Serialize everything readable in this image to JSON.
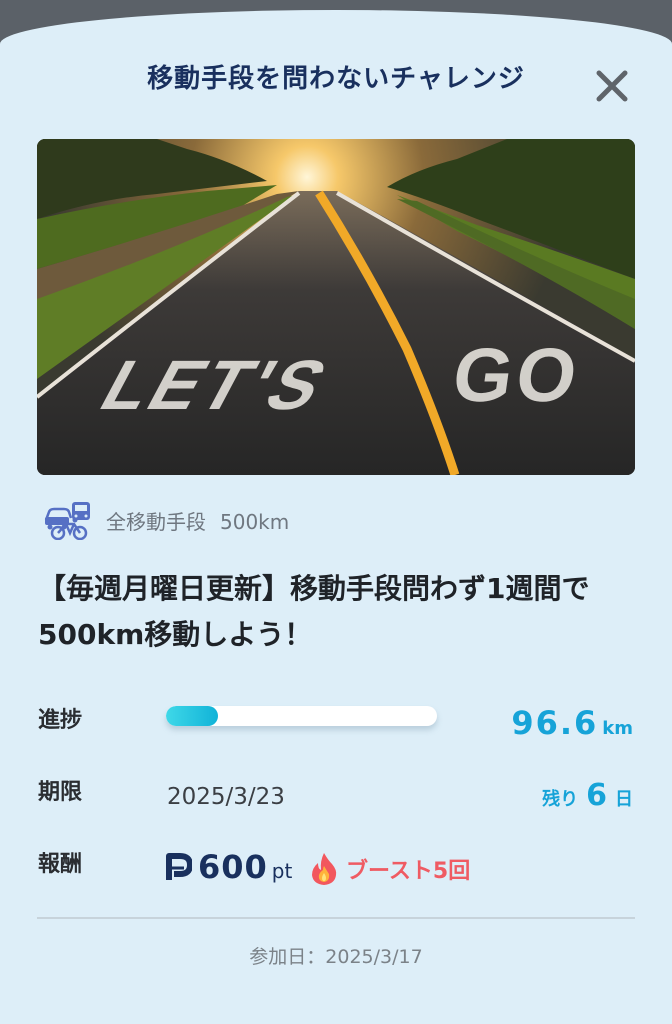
{
  "header": {
    "title": "移動手段を問わないチャレンジ"
  },
  "hero": {
    "image_text": "LET'S GO"
  },
  "category": {
    "label": "全移動手段",
    "distance": "500km",
    "icon": "transport-bike-icon"
  },
  "headline": "【毎週月曜日更新】移動手段問わず1週間で500km移動しよう！",
  "progress": {
    "label": "進捗",
    "value": "96.6",
    "unit": "km",
    "fraction": 0.193
  },
  "deadline": {
    "label": "期限",
    "date": "2025/3/23",
    "remaining_prefix": "残り",
    "remaining_days": "6",
    "remaining_unit": "日"
  },
  "reward": {
    "label": "報酬",
    "points": "600",
    "points_unit": "pt",
    "boost_text": "ブースト5回",
    "boost_icon": "fire-icon"
  },
  "footer": {
    "joined": "参加日：2025/3/17"
  },
  "colors": {
    "accent": "#16a3d8",
    "navy": "#19305e",
    "boost": "#ef5b63",
    "background": "#ddeef8"
  }
}
